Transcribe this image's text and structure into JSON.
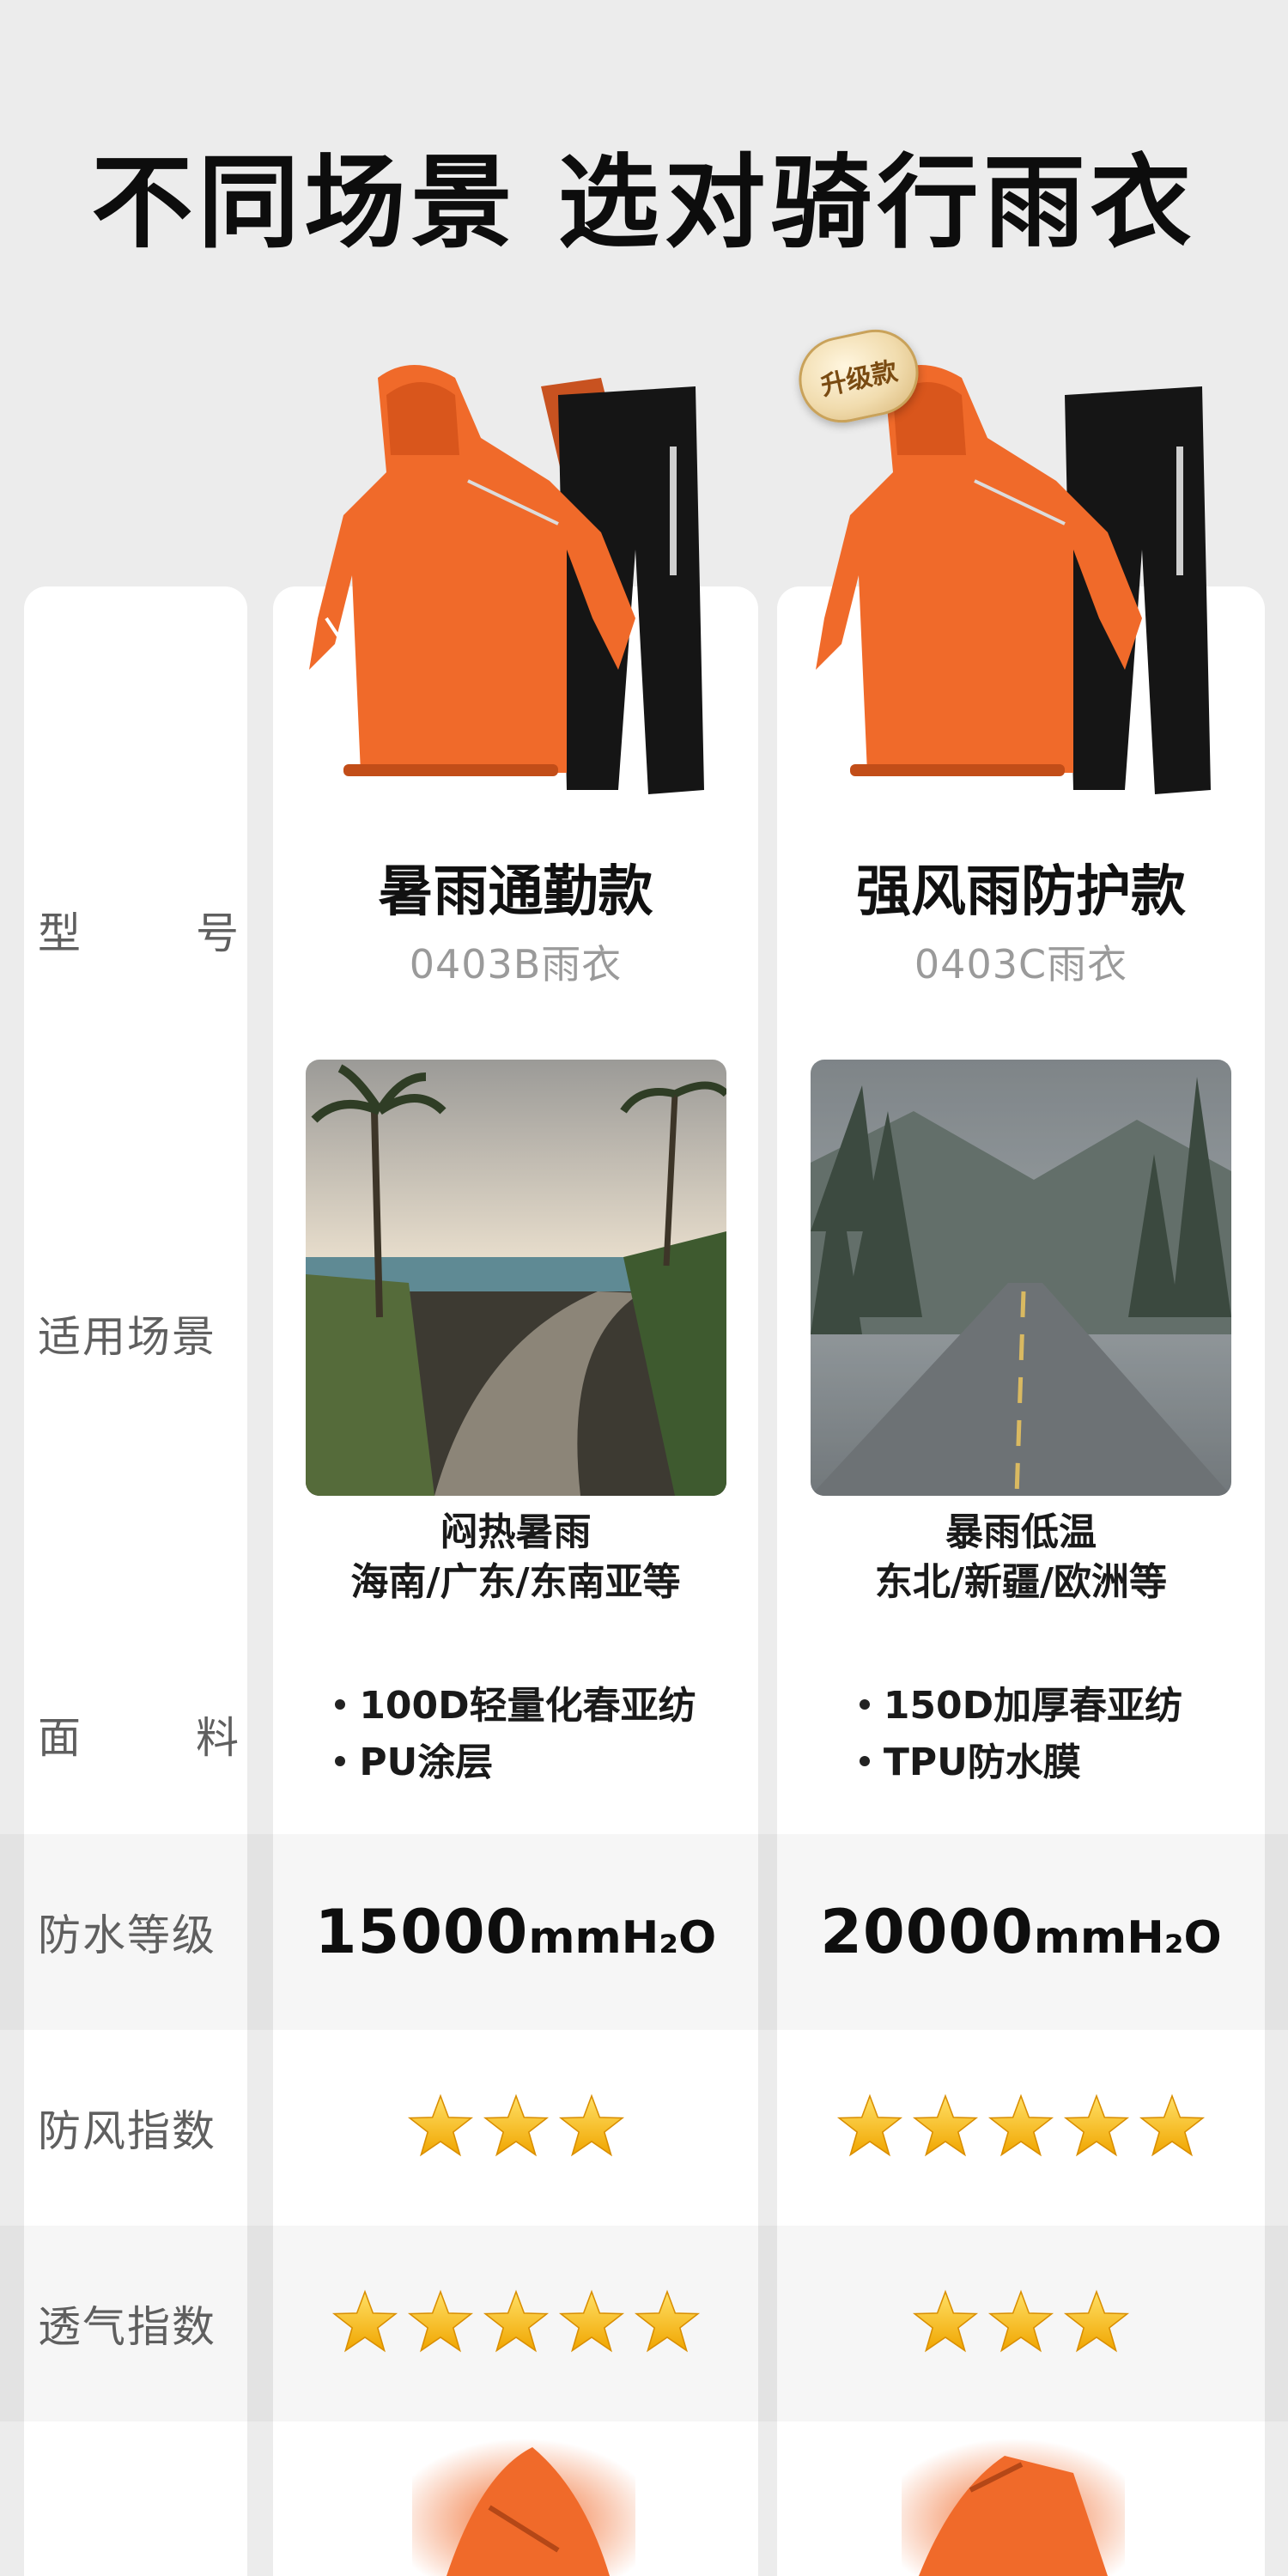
{
  "title": "不同场景  选对骑行雨衣",
  "labels": {
    "model": [
      "型",
      "号"
    ],
    "scene": "适用场景",
    "fabric": [
      "面",
      "料"
    ],
    "waterproof": "防水等级",
    "wind": "防风指数",
    "breath": "透气指数"
  },
  "products": [
    {
      "name": "暑雨通勤款",
      "code": "0403B雨衣",
      "scene_line1": "闷热暑雨",
      "scene_line2": "海南/广东/东南亚等",
      "fabric": [
        "100D轻量化春亚纺",
        "PU涂层"
      ],
      "waterproof_num": "15000",
      "waterproof_unit": "mmH₂O",
      "wind_stars": 3,
      "breath_stars": 5
    },
    {
      "name": "强风雨防护款",
      "code": "0403C雨衣",
      "badge": "升级款",
      "scene_line1": "暴雨低温",
      "scene_line2": "东北/新疆/欧洲等",
      "fabric": [
        "150D加厚春亚纺",
        "TPU防水膜"
      ],
      "waterproof_num": "20000",
      "waterproof_unit": "mmH₂O",
      "wind_stars": 5,
      "breath_stars": 3
    }
  ],
  "icons": {
    "star": "star-icon",
    "jacket": "raincoat-jacket-icon",
    "pants": "rain-pants-icon"
  },
  "colors": {
    "orange": "#f06a2a",
    "star_gold": "#f5b300",
    "background": "#ececec"
  }
}
